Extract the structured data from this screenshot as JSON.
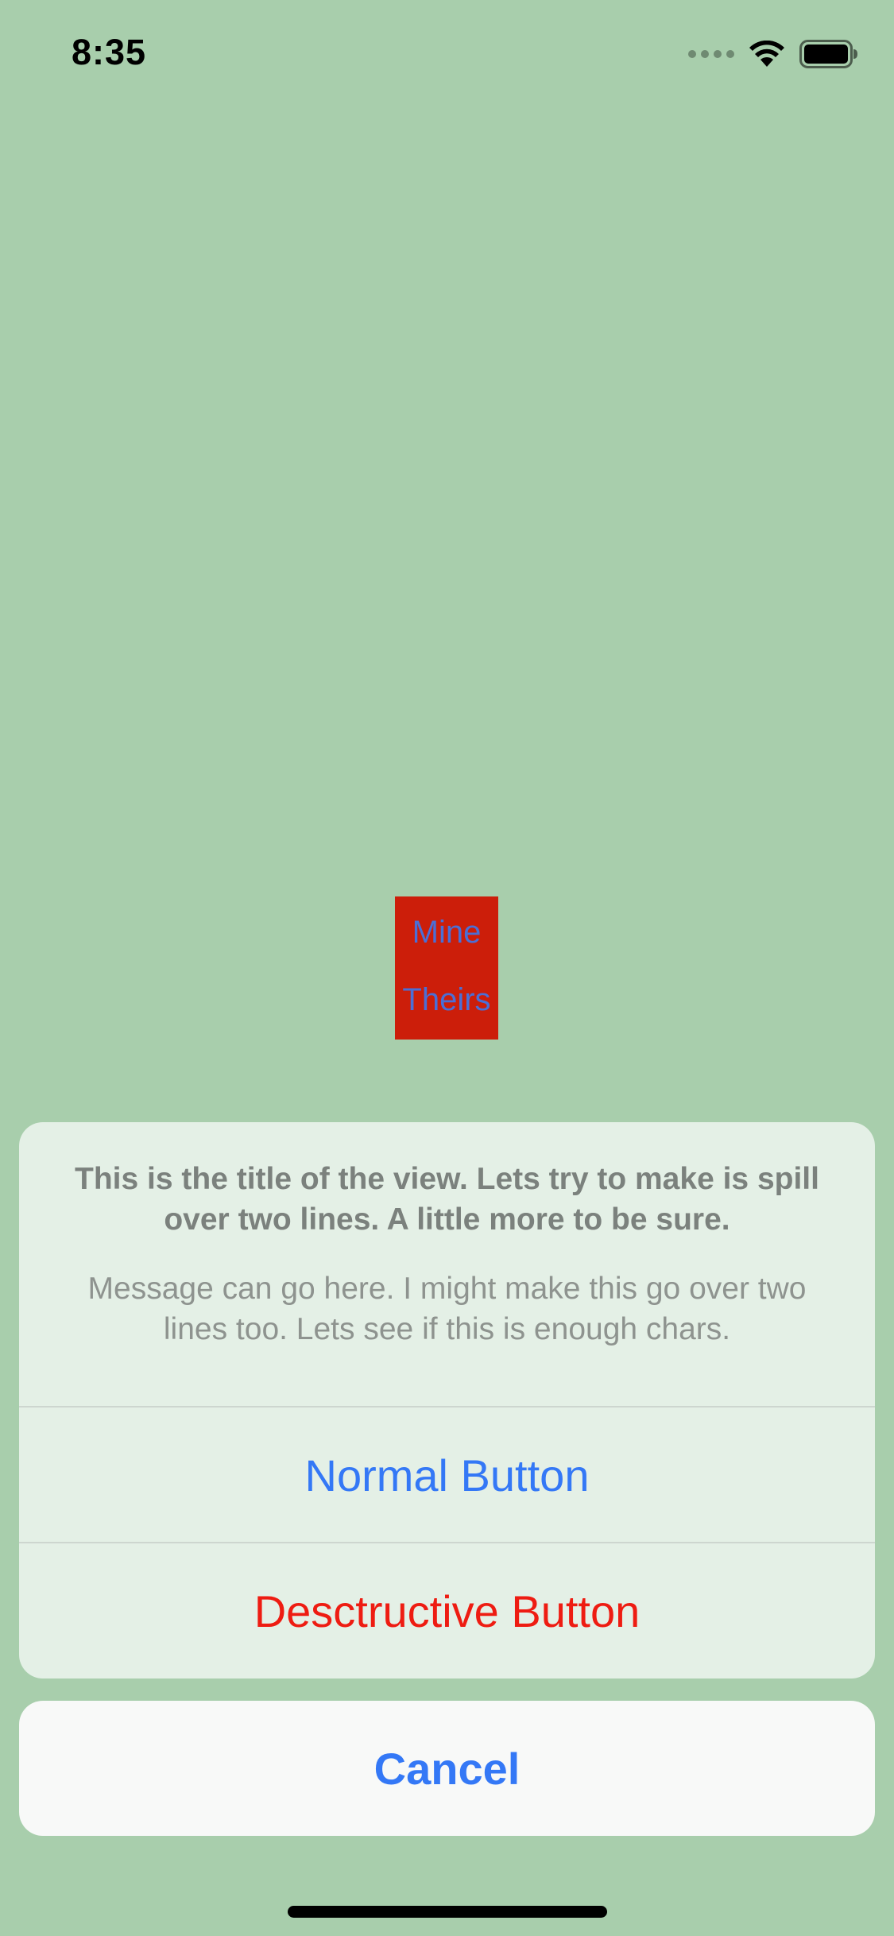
{
  "status_bar": {
    "time": "8:35",
    "icons": [
      "cellular-signal-icon",
      "wifi-icon",
      "battery-icon"
    ]
  },
  "picker": {
    "items": [
      "Mine",
      "Theirs"
    ],
    "background_color": "#cc1e0a",
    "text_color": "#4a6fd6"
  },
  "action_sheet": {
    "title": "This is the title of the view. Lets try to make is spill over two lines. A little more to be sure.",
    "message": "Message can go here. I might make this go over two lines too. Lets see if this is enough chars.",
    "buttons": [
      {
        "label": "Normal Button",
        "style": "default",
        "color": "#3478f6"
      },
      {
        "label": "Desctructive Button",
        "style": "destructive",
        "color": "#ee1c12"
      }
    ],
    "cancel_label": "Cancel"
  },
  "colors": {
    "background": "#a8ceac",
    "accent": "#3478f6",
    "destructive": "#ee1c12"
  }
}
